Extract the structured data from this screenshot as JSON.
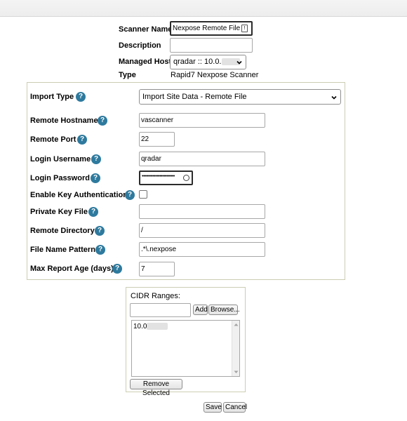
{
  "form": {
    "scanner_name": {
      "label": "Scanner Name",
      "value": "Nexpose Remote File"
    },
    "description": {
      "label": "Description",
      "value": ""
    },
    "managed_host": {
      "label": "Managed Host",
      "value": "qradar :: 10.0."
    },
    "type": {
      "label": "Type",
      "value": "Rapid7 Nexpose Scanner"
    }
  },
  "settings": {
    "help_glyph": "?",
    "import_type": {
      "label": "Import Type",
      "value": "Import Site Data - Remote File"
    },
    "remote_hostname": {
      "label": "Remote Hostname",
      "value": "vascanner"
    },
    "remote_port": {
      "label": "Remote Port",
      "value": "22"
    },
    "login_username": {
      "label": "Login Username",
      "value": "qradar"
    },
    "login_password": {
      "label": "Login Password",
      "value": "••••••••••••••••••••••••"
    },
    "enable_key_auth": {
      "label": "Enable Key Authentication",
      "checked": false
    },
    "private_key_file": {
      "label": "Private Key File",
      "value": ""
    },
    "remote_directory": {
      "label": "Remote Directory",
      "value": "/"
    },
    "file_name_pattern": {
      "label": "File Name Pattern",
      "value": ".*\\.nexpose"
    },
    "max_report_age": {
      "label": "Max Report Age (days)",
      "value": "7"
    }
  },
  "cidr": {
    "title": "CIDR Ranges:",
    "input_value": "",
    "add_label": "Add",
    "browse_label": "Browse...",
    "items": [
      "10.0"
    ],
    "remove_label": "Remove Selected"
  },
  "actions": {
    "save_label": "Save",
    "cancel_label": "Cancel"
  },
  "colors": {
    "help_icon": "#2e7a9e",
    "panel_border": "#cdcdb4"
  }
}
